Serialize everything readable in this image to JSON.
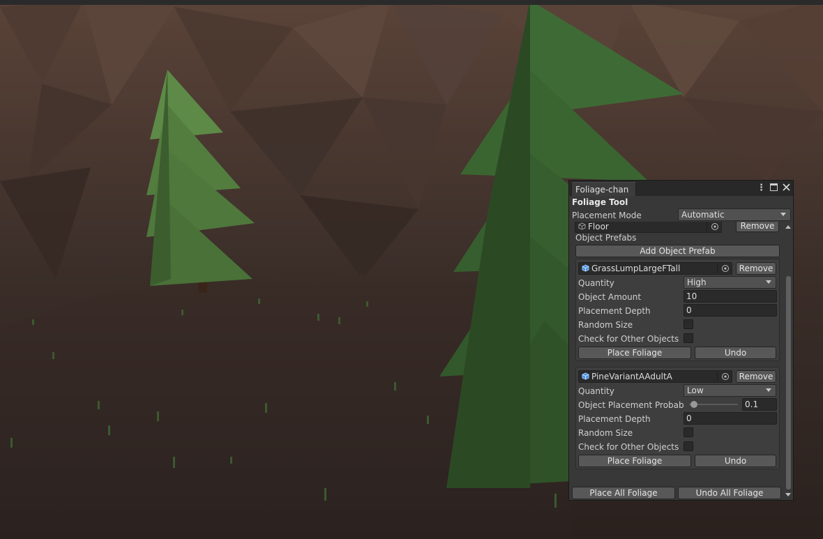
{
  "window": {
    "tab_title": "Foliage-chan"
  },
  "tool": {
    "heading": "Foliage Tool",
    "placement_mode_label": "Placement Mode",
    "placement_mode_value": "Automatic",
    "surface_object": "Floor",
    "surface_remove_label": "Remove",
    "object_prefabs_label": "Object Prefabs",
    "add_prefab_label": "Add Object Prefab"
  },
  "prefabs": [
    {
      "name": "GrassLumpLargeFTall",
      "remove_label": "Remove",
      "quantity_label": "Quantity",
      "quantity_value": "High",
      "amount_label": "Object Amount",
      "amount_value": "10",
      "depth_label": "Placement Depth",
      "depth_value": "0",
      "random_size_label": "Random Size",
      "random_size_checked": false,
      "check_other_label": "Check for Other Objects",
      "check_other_checked": false,
      "place_label": "Place Foliage",
      "undo_label": "Undo"
    },
    {
      "name": "PineVariantAAdultA",
      "remove_label": "Remove",
      "quantity_label": "Quantity",
      "quantity_value": "Low",
      "probability_label": "Object Placement Probabil",
      "probability_value": "0.1",
      "probability_fraction": 0.1,
      "depth_label": "Placement Depth",
      "depth_value": "0",
      "random_size_label": "Random Size",
      "random_size_checked": false,
      "check_other_label": "Check for Other Objects",
      "check_other_checked": false,
      "place_label": "Place Foliage",
      "undo_label": "Undo"
    }
  ],
  "footer": {
    "place_all_label": "Place All Foliage",
    "undo_all_label": "Undo All Foliage"
  }
}
